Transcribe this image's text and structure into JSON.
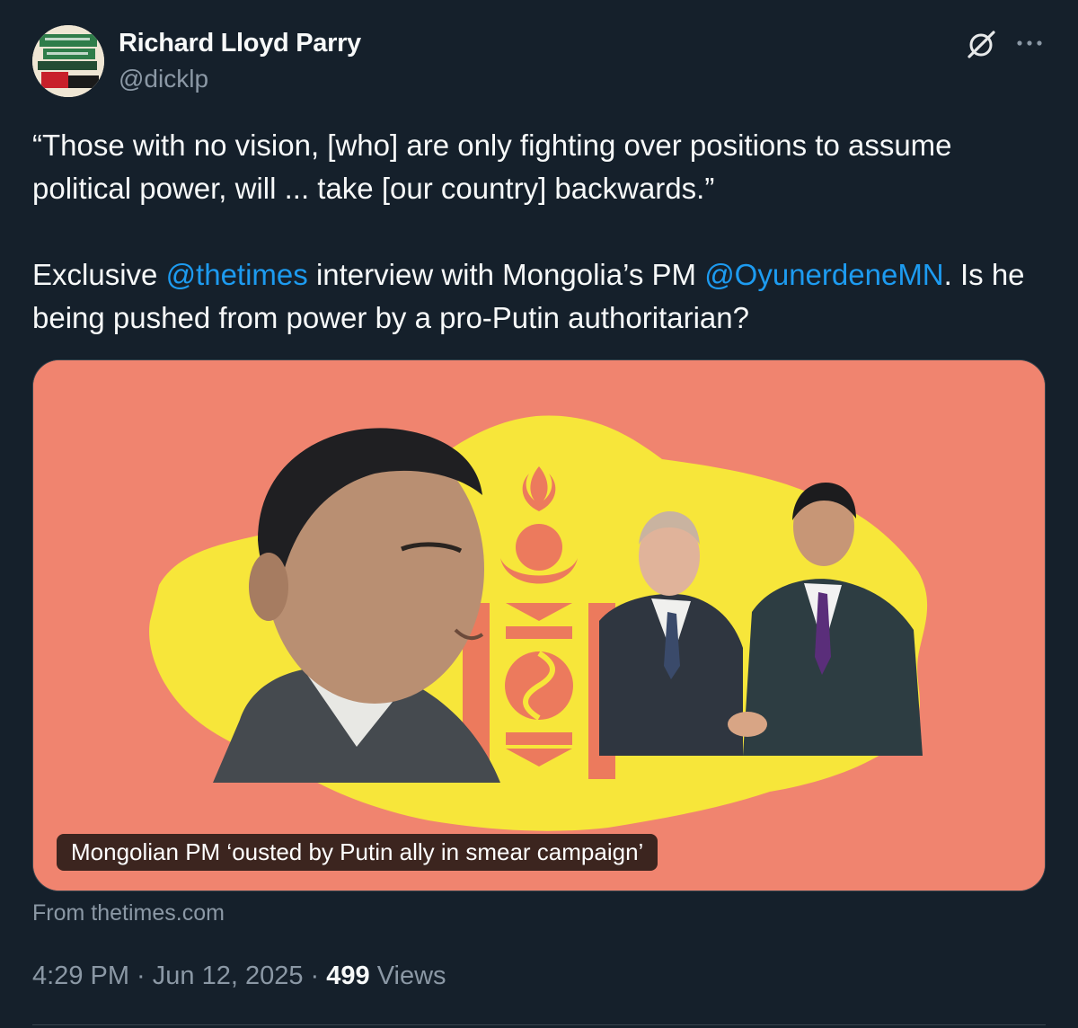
{
  "author": {
    "display_name": "Richard Lloyd Parry",
    "handle": "@dicklp",
    "avatar_icon": "book-cover-avatar"
  },
  "header_icons": [
    "grok-icon",
    "more-options-icon"
  ],
  "tweet": {
    "quote": "“Those with no vision, [who] are only fighting over positions to assume political power, will ... take [our country] backwards.”",
    "line2_prefix": "Exclusive ",
    "mention_1": "@thetimes",
    "line2_middle": " interview with Mongolia’s PM ",
    "mention_2": "@OyunerdeneMN",
    "line2_suffix": ". Is he being pushed from power by a pro-Putin authoritarian?"
  },
  "card": {
    "headline": "Mongolian PM ‘ousted by Putin ally in smear campaign’",
    "source": "From thetimes.com",
    "background_color": "#f0846f",
    "map_color": "#f7e63a"
  },
  "meta": {
    "time": "4:29 PM",
    "separator": " · ",
    "date": "Jun 12, 2025",
    "views_count": "499",
    "views_label": " Views"
  },
  "colors": {
    "background": "#15202b",
    "text": "#f7f9f9",
    "secondary": "#8b98a5",
    "link": "#1d9bf0",
    "border": "#38444d"
  }
}
